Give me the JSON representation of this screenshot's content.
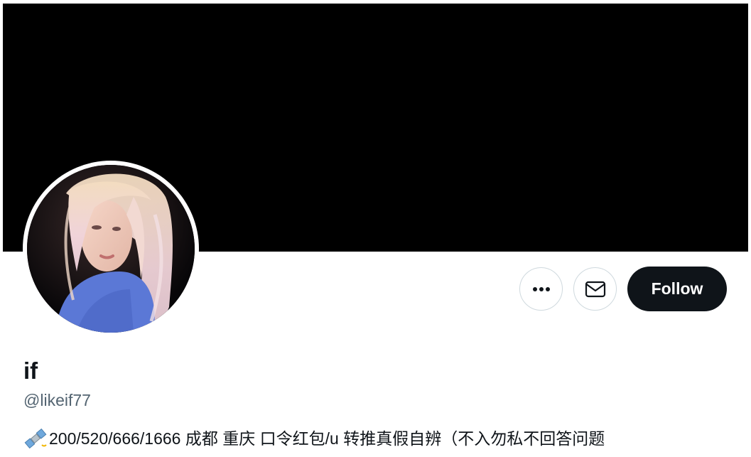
{
  "profile": {
    "display_name": "if",
    "handle": "@likeif77",
    "bio_text": "200/520/666/1666 成都 重庆 口令红包/u 转推真假自辨（不入勿私不回答问题",
    "bio_emoji": "satellite-icon"
  },
  "actions": {
    "more_icon": "more-horizontal-icon",
    "message_icon": "envelope-icon",
    "follow_label": "Follow"
  },
  "colors": {
    "banner": "#000000",
    "follow_bg": "#0f1419",
    "handle_text": "#536471",
    "button_border": "#cfd9de"
  }
}
